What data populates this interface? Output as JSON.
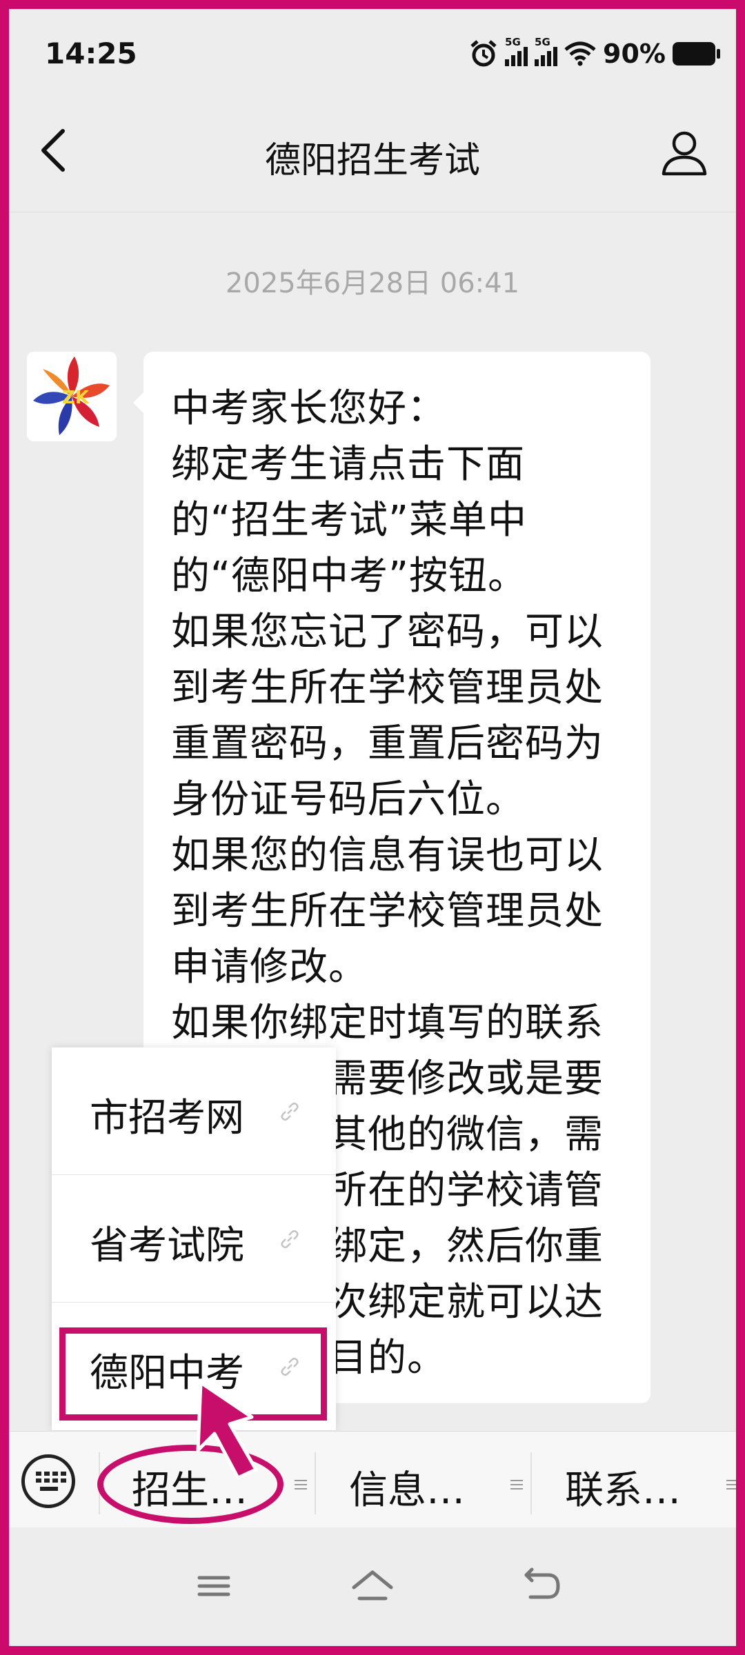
{
  "status_bar": {
    "time": "14:25",
    "network_1": "5G",
    "network_2": "5G",
    "battery_percent": "90%",
    "icons": [
      "alarm-icon",
      "signal-5g-icon",
      "signal-5g-icon",
      "wifi-icon",
      "battery-icon"
    ]
  },
  "nav": {
    "title": "德阳招生考试",
    "back_icon": "chevron-left-icon",
    "profile_icon": "user-icon"
  },
  "chat": {
    "timestamp": "2025年6月28日 06:41",
    "avatar_text": "ZK",
    "message_paragraphs": [
      "中考家长您好：",
      "绑定考生请点击下面的“招生考试”菜单中的“德阳中考”按钮。",
      "如果您忘记了密码，可以到考生所在学校管理员处重置密码，重置后密码为身份证号码后六位。",
      "如果您的信息有误也可以到考生所在学校管理员处申请修改。",
      "如果你绑定时填写的联系人手机号需要修改或是要重新绑定其他的微信，需要到考生所在的学校请管理员解除绑定，然后你重新再做一次绑定就可以达到修改的目的。"
    ]
  },
  "popup_menu": {
    "items": [
      {
        "label": "市招考网",
        "icon": "link-icon"
      },
      {
        "label": "省考试院",
        "icon": "link-icon"
      },
      {
        "label": "德阳中考",
        "icon": "link-icon"
      }
    ]
  },
  "bottom_menu": {
    "keyboard_icon": "keyboard-icon",
    "tabs": [
      {
        "label": "招生…"
      },
      {
        "label": "信息…"
      },
      {
        "label": "联系…"
      }
    ]
  },
  "system_nav": {
    "icons": [
      "menu-icon",
      "home-icon",
      "back-icon"
    ]
  },
  "colors": {
    "annotation": "#c80e6b",
    "background": "#ededed",
    "bubble": "#ffffff"
  }
}
